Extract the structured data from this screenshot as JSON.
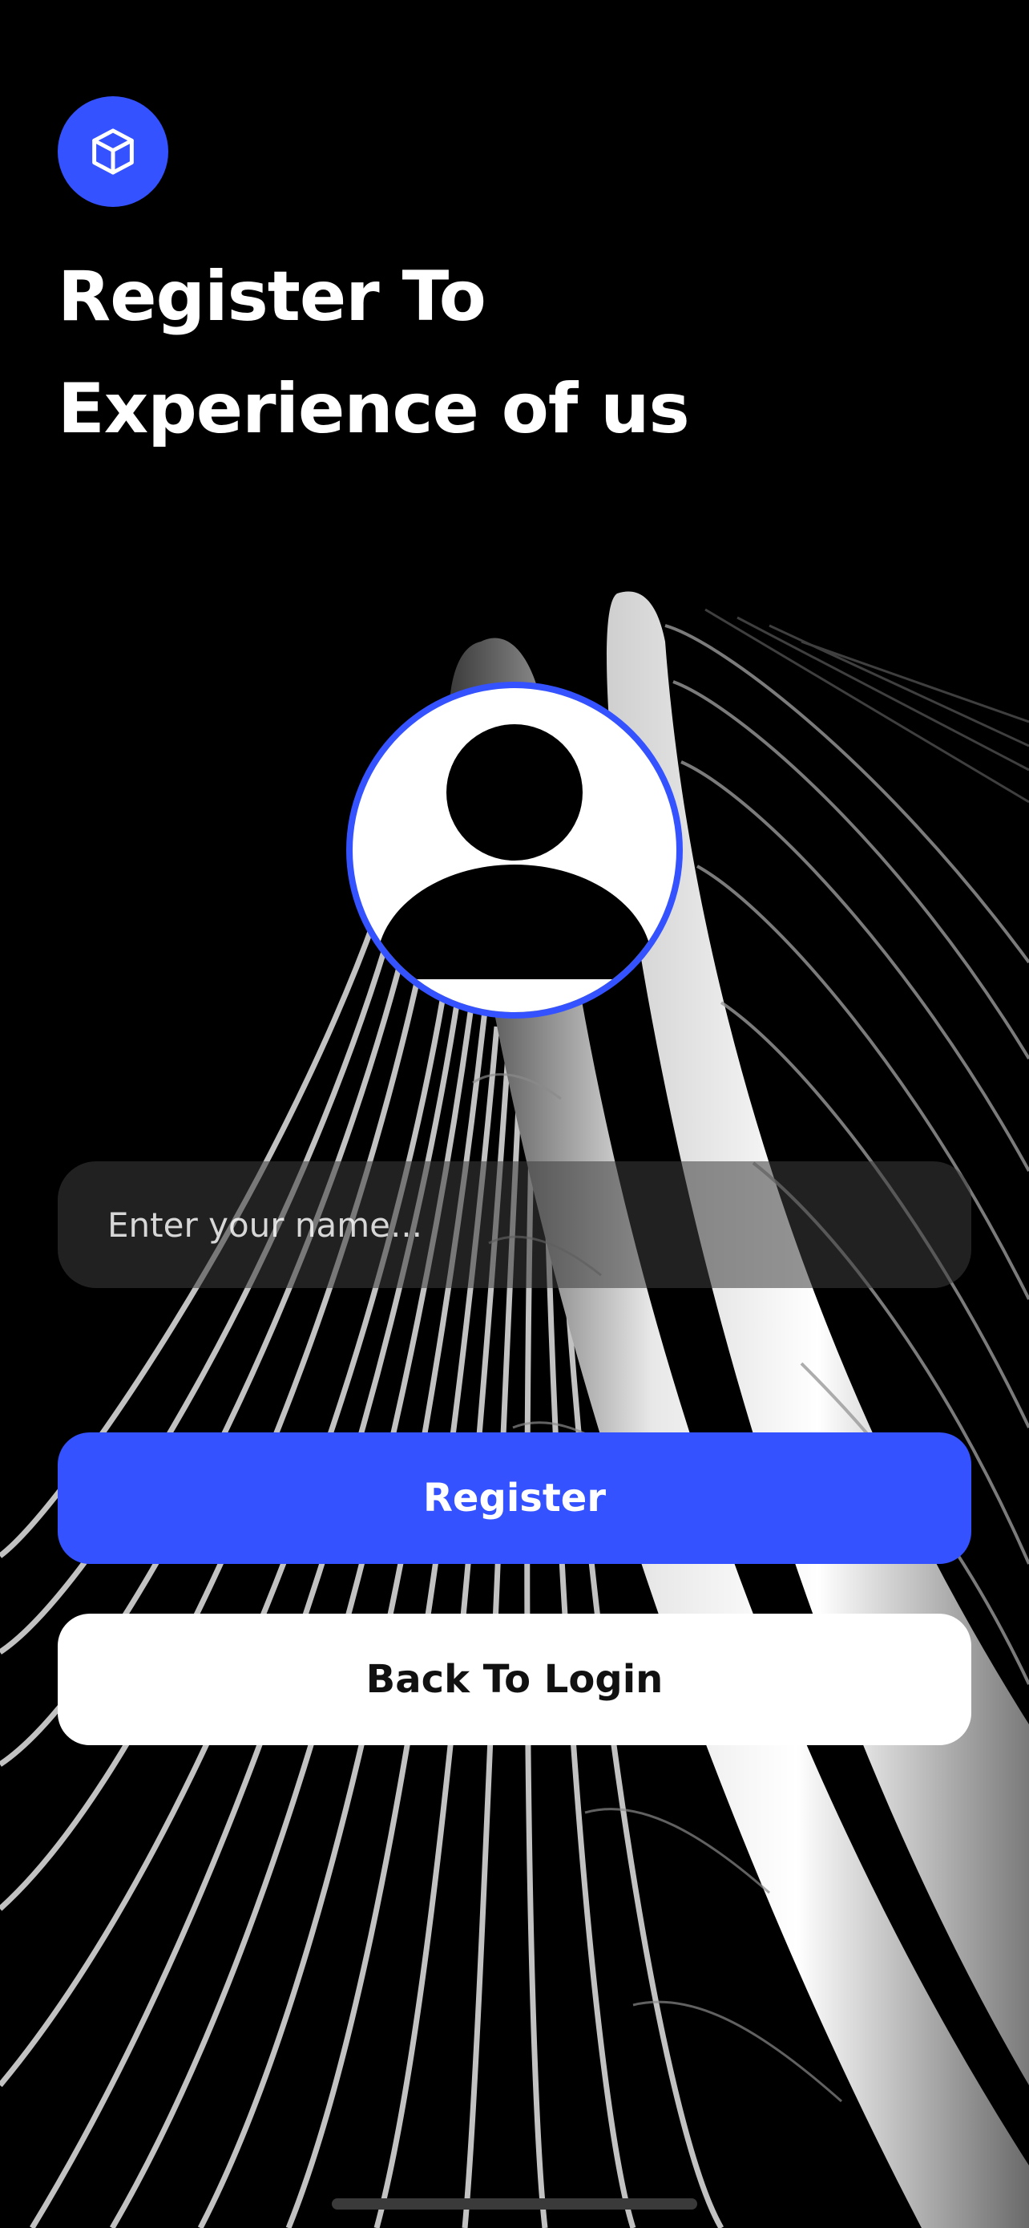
{
  "header": {
    "logo_icon": "cube-icon",
    "title_line1": "Register To",
    "title_line2": "Experience of us"
  },
  "avatar": {
    "icon": "user-silhouette-icon"
  },
  "form": {
    "name_placeholder": "Enter your name...",
    "name_value": ""
  },
  "actions": {
    "register_label": "Register",
    "back_label": "Back To Login"
  },
  "theme": {
    "accent": "#3452FF",
    "background": "#000000",
    "secondary_button": "#FFFFFF"
  }
}
